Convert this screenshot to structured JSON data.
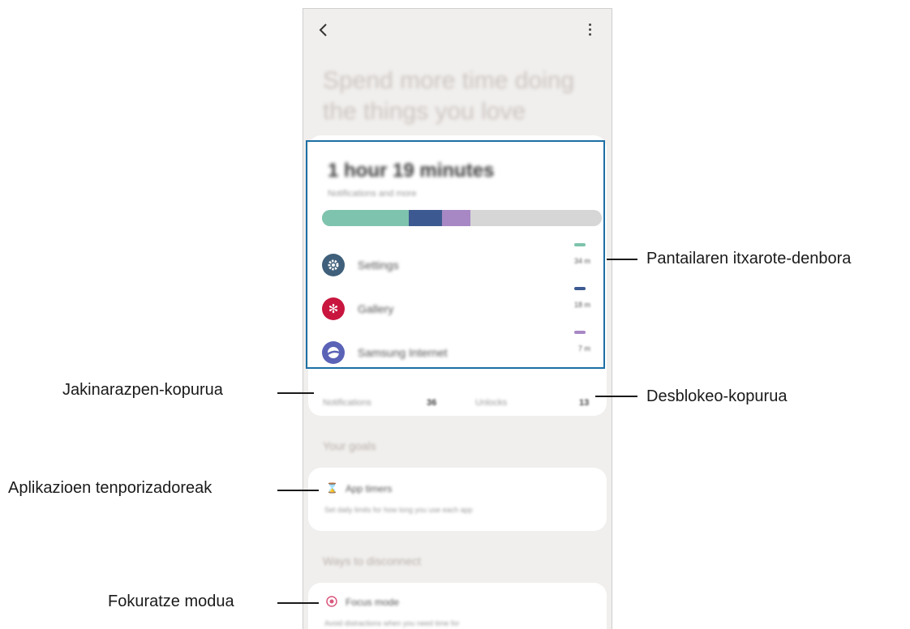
{
  "header": {
    "back_icon": "chevron-left-icon",
    "more_icon": "more-vertical-icon"
  },
  "headline": "Spend more time doing the things you love",
  "screen_time": {
    "total": "1 hour 19 minutes",
    "subtitle": "Notifications and more"
  },
  "usage_bar": {
    "segments": [
      {
        "name": "Settings",
        "color": "#7ec3ad",
        "fraction": 0.31
      },
      {
        "name": "Gallery",
        "color": "#3c5a91",
        "fraction": 0.12
      },
      {
        "name": "Samsung Internet",
        "color": "#a788c4",
        "fraction": 0.1
      }
    ],
    "track_color": "#d6d6d6"
  },
  "apps": [
    {
      "name": "Settings",
      "time": "34 m",
      "icon": "gear-icon",
      "icon_color": "#3f5f7a",
      "dash_color": "#7ec3ad"
    },
    {
      "name": "Gallery",
      "time": "18 m",
      "icon": "flower-icon",
      "icon_color": "#c8163f",
      "dash_color": "#3c5a91"
    },
    {
      "name": "Samsung Internet",
      "time": "7 m",
      "icon": "planet-icon",
      "icon_color": "#5a63b6",
      "dash_color": "#a788c4"
    }
  ],
  "stats": {
    "notifications_label": "Notifications",
    "notifications_value": "36",
    "unlocks_label": "Unlocks",
    "unlocks_value": "13"
  },
  "goals": {
    "section_title": "Your goals",
    "app_timers_title": "App timers",
    "app_timers_desc": "Set daily limits for how long you use each app",
    "app_timers_icon": "hourglass-icon"
  },
  "disconnect": {
    "section_title": "Ways to disconnect",
    "focus_title": "Focus mode",
    "focus_desc": "Avoid distractions when you need time for",
    "focus_icon": "target-icon"
  },
  "callouts": {
    "screen_time": "Pantailaren itxarote-denbora",
    "notifications": "Jakinarazpen-kopurua",
    "unlocks": "Desblokeo-kopurua",
    "app_timers": "Aplikazioen tenporizadoreak",
    "focus_mode": "Fokuratze modua"
  },
  "colors": {
    "highlight_border": "#1d6fa5",
    "screen_bg": "#f1efed"
  }
}
